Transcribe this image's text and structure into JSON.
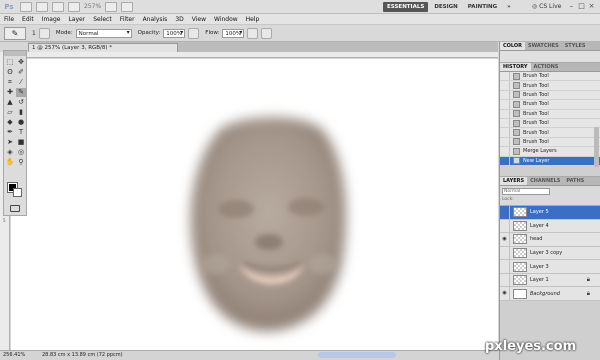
{
  "app": {
    "logo": "Ps",
    "zoom_mini": "257%",
    "workspaces": [
      "ESSENTIALS",
      "DESIGN",
      "PAINTING",
      "»"
    ],
    "cslive": "CS Live",
    "window_controls": [
      "–",
      "□",
      "×"
    ]
  },
  "menu": [
    "File",
    "Edit",
    "Image",
    "Layer",
    "Select",
    "Filter",
    "Analysis",
    "3D",
    "View",
    "Window",
    "Help"
  ],
  "options": {
    "brush_size": "1",
    "mode_label": "Mode:",
    "mode_value": "Normal",
    "opacity_label": "Opacity:",
    "opacity_value": "100%",
    "flow_label": "Flow:",
    "flow_value": "100%"
  },
  "document": {
    "tab_title": "1 @ 257% (Layer 3, RGB/8) *",
    "ruler_number": "5"
  },
  "status": {
    "zoom": "256.41%",
    "doc_size": "28.83 cm x 13.89 cm (72 ppcm)"
  },
  "panels": {
    "color_tabs": [
      "COLOR",
      "SWATCHES",
      "STYLES"
    ],
    "history_tabs": [
      "HISTORY",
      "ACTIONS"
    ],
    "history": [
      "Brush Tool",
      "Brush Tool",
      "Brush Tool",
      "Brush Tool",
      "Brush Tool",
      "Brush Tool",
      "Brush Tool",
      "Brush Tool",
      "Merge Layers",
      "New Layer"
    ],
    "history_active_index": 9,
    "layers_tabs": [
      "LAYERS",
      "CHANNELS",
      "PATHS"
    ],
    "blend_mode": "Normal",
    "lock_label": "Lock:",
    "layers": [
      {
        "name": "Layer 5",
        "visible": false,
        "active": true
      },
      {
        "name": "Layer 4",
        "visible": false,
        "active": false
      },
      {
        "name": "head",
        "visible": true,
        "active": false
      },
      {
        "name": "Layer 3 copy",
        "visible": false,
        "active": false
      },
      {
        "name": "Layer 3",
        "visible": false,
        "active": false
      },
      {
        "name": "Layer 1",
        "visible": false,
        "active": false,
        "locked": true
      },
      {
        "name": "Background",
        "visible": true,
        "active": false,
        "locked": true,
        "italic": true
      }
    ]
  },
  "watermark": "pxleyes.com",
  "colors": {
    "accent": "#3a6fc4",
    "face": "#a4958a"
  }
}
